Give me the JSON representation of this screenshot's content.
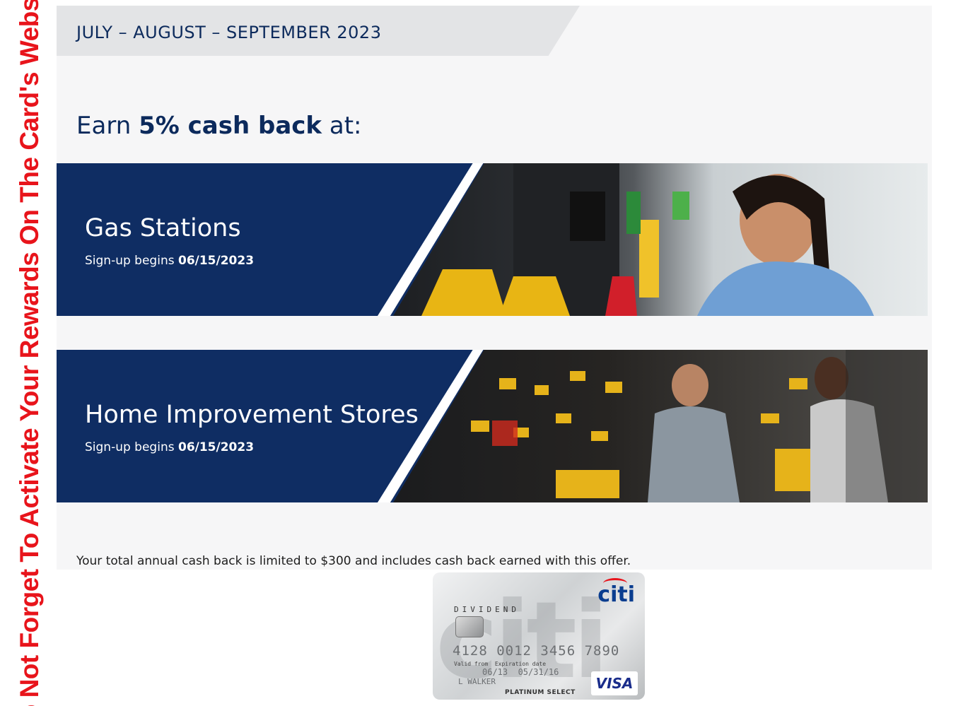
{
  "side_banner": {
    "text": "Do Not Forget To Activate Your Rewards On The Card's Website"
  },
  "header": {
    "season": "JULY – AUGUST – SEPTEMBER 2023"
  },
  "headline": {
    "prefix": "Earn ",
    "bold": "5% cash back",
    "suffix": " at:"
  },
  "categories": [
    {
      "title": "Gas Stations",
      "signup_label": "Sign-up begins ",
      "signup_date": "06/15/2023",
      "photo": "gas-pump-photo"
    },
    {
      "title": "Home Improvement Stores",
      "signup_label": "Sign-up begins ",
      "signup_date": "06/15/2023",
      "photo": "power-tools-photo"
    }
  ],
  "footnote": "Your total annual cash back is limited to $300 and includes cash back earned with this offer.",
  "card": {
    "brand": "citi",
    "product": "DIVIDEND",
    "number": "4128 0012 3456 7890",
    "valid_label": "Valid from",
    "expiry_label": "Expiration date",
    "valid_date": "06/13",
    "expiry_date": "05/31/16",
    "holder": "L WALKER",
    "tier": "PLATINUM SELECT",
    "network": "VISA"
  },
  "colors": {
    "navy": "#0f2d63",
    "banner_red": "#e8141b",
    "panel": "#f6f6f7"
  }
}
